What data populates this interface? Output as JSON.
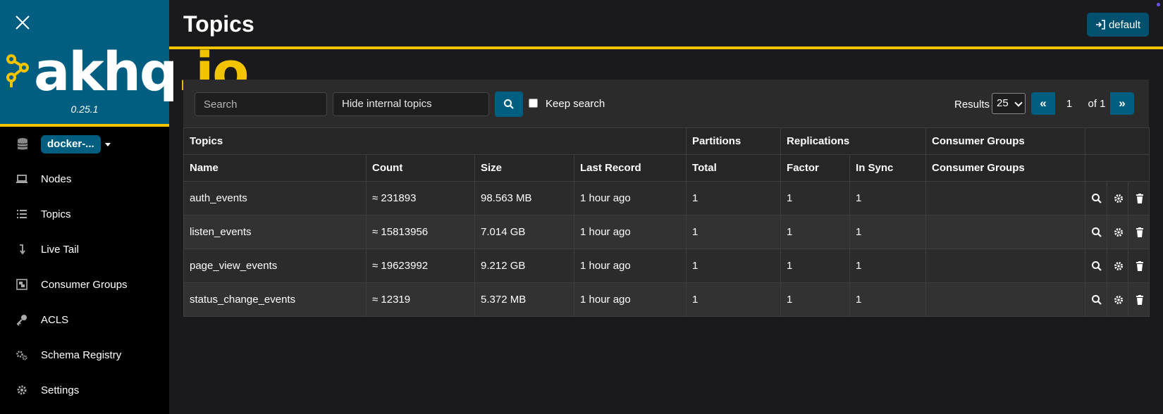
{
  "sidebar": {
    "brand": {
      "logo_main": "akhq",
      "logo_dot": ".io",
      "version": "0.25.1"
    },
    "cluster": "docker-...",
    "items": [
      {
        "label": "Nodes",
        "icon": "laptop-icon"
      },
      {
        "label": "Topics",
        "icon": "list-icon"
      },
      {
        "label": "Live Tail",
        "icon": "level-down-icon"
      },
      {
        "label": "Consumer Groups",
        "icon": "object-group-icon"
      },
      {
        "label": "ACLS",
        "icon": "key-icon"
      },
      {
        "label": "Schema Registry",
        "icon": "cogs-icon"
      },
      {
        "label": "Settings",
        "icon": "gear-icon"
      }
    ]
  },
  "header": {
    "title": "Topics",
    "login_label": "default"
  },
  "toolbar": {
    "search_placeholder": "Search",
    "filter_value": "Hide internal topics",
    "keep_search_label": "Keep search",
    "results_label": "Results",
    "results_value": "25",
    "page_first": "«",
    "page_current": "1",
    "page_of": "of 1",
    "page_last": "»"
  },
  "table": {
    "group_headers": [
      "Topics",
      "Partitions",
      "Replications",
      "Consumer Groups",
      ""
    ],
    "columns": [
      "Name",
      "Count",
      "Size",
      "Last Record",
      "Total",
      "Factor",
      "In Sync",
      "Consumer Groups"
    ],
    "rows": [
      {
        "name": "auth_events",
        "count": "≈ 231893",
        "size": "98.563 MB",
        "last_record": "1 hour ago",
        "total": "1",
        "factor": "1",
        "in_sync": "1",
        "consumer_groups": ""
      },
      {
        "name": "listen_events",
        "count": "≈ 15813956",
        "size": "7.014 GB",
        "last_record": "1 hour ago",
        "total": "1",
        "factor": "1",
        "in_sync": "1",
        "consumer_groups": ""
      },
      {
        "name": "page_view_events",
        "count": "≈ 19623992",
        "size": "9.212 GB",
        "last_record": "1 hour ago",
        "total": "1",
        "factor": "1",
        "in_sync": "1",
        "consumer_groups": ""
      },
      {
        "name": "status_change_events",
        "count": "≈ 12319",
        "size": "5.372 MB",
        "last_record": "1 hour ago",
        "total": "1",
        "factor": "1",
        "in_sync": "1",
        "consumer_groups": ""
      }
    ]
  },
  "colors": {
    "brand": "#005f81",
    "accent": "#f2c400",
    "background": "#1a1a1c",
    "sidebar": "#000000"
  }
}
